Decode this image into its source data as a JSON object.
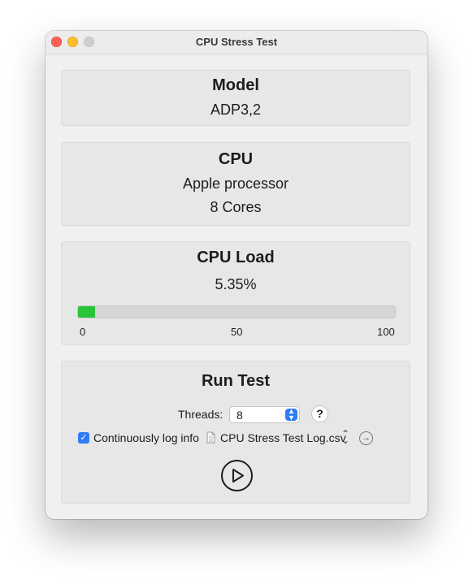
{
  "window": {
    "title": "CPU Stress Test"
  },
  "model": {
    "title": "Model",
    "value": "ADP3,2"
  },
  "cpu": {
    "title": "CPU",
    "name": "Apple processor",
    "cores": "8 Cores"
  },
  "load": {
    "title": "CPU Load",
    "value_text": "5.35%",
    "percent": 5.35,
    "ticks": [
      "0",
      "50",
      "100"
    ],
    "bar_color": "#29c43a"
  },
  "run": {
    "title": "Run Test",
    "threads_label": "Threads:",
    "threads_value": "8",
    "help_label": "?",
    "log_label": "Continuously log info",
    "log_checked": true,
    "log_file": "CPU Stress Test Log.csv",
    "icons": [
      "file-icon",
      "updown-chevron-icon",
      "reveal-arrow-icon",
      "play-icon"
    ]
  },
  "colors": {
    "accent": "#2f7df6",
    "close": "#fe5f57",
    "minimize": "#febc2e",
    "zoom_disabled": "#cfcfcf"
  }
}
